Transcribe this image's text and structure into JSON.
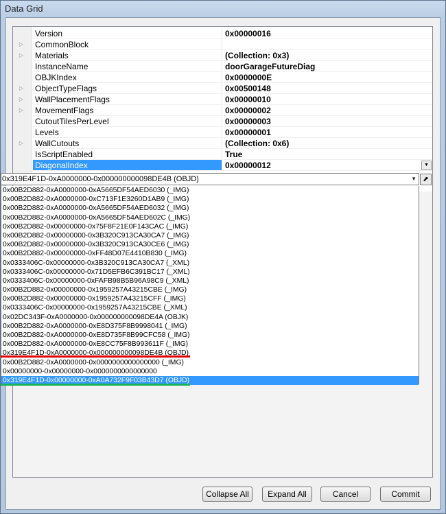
{
  "window": {
    "title": "Data Grid"
  },
  "properties": [
    {
      "name": "Version",
      "value": "0x00000016",
      "expandable": false
    },
    {
      "name": "CommonBlock",
      "value": "",
      "expandable": true
    },
    {
      "name": "Materials",
      "value": "(Collection: 0x3)",
      "expandable": true
    },
    {
      "name": "InstanceName",
      "value": "doorGarageFutureDiag",
      "expandable": false
    },
    {
      "name": "OBJKIndex",
      "value": "0x0000000E",
      "expandable": false
    },
    {
      "name": "ObjectTypeFlags",
      "value": "0x00500148",
      "expandable": true
    },
    {
      "name": "WallPlacementFlags",
      "value": "0x00000010",
      "expandable": true
    },
    {
      "name": "MovementFlags",
      "value": "0x00000002",
      "expandable": true
    },
    {
      "name": "CutoutTilesPerLevel",
      "value": "0x00000003",
      "expandable": false
    },
    {
      "name": "Levels",
      "value": "0x00000001",
      "expandable": false
    },
    {
      "name": "WallCutouts",
      "value": "(Collection: 0x6)",
      "expandable": true
    },
    {
      "name": "IsScriptEnabled",
      "value": "True",
      "expandable": false
    },
    {
      "name": "DiagonalIndex",
      "value": "0x00000012",
      "expandable": false,
      "selected": true
    }
  ],
  "combo": {
    "selected_value": "0x319E4F1D-0xA0000000-0x000000000098DE4B (OBJD)"
  },
  "dropdown_items": [
    "0x00B2D882-0xA0000000-0xA5665DF54AED6030 (_IMG)",
    "0x00B2D882-0xA0000000-0xC713F1E3260D1AB9 (_IMG)",
    "0x00B2D882-0xA0000000-0xA5665DF54AED6032 (_IMG)",
    "0x00B2D882-0xA0000000-0xA5665DF54AED602C (_IMG)",
    "0x00B2D882-0x00000000-0x75F8F21E0F143CAC (_IMG)",
    "0x00B2D882-0x00000000-0x3B320C913CA30CA7 (_IMG)",
    "0x00B2D882-0x00000000-0x3B320C913CA30CE6 (_IMG)",
    "0x00B2D882-0x00000000-0xFF48D07E4410B830 (_IMG)",
    "0x0333406C-0x00000000-0x3B320C913CA30CA7 (_XML)",
    "0x0333406C-0x00000000-0x71D5EFB6C391BC17 (_XML)",
    "0x0333406C-0x00000000-0xFAFB98B5B96A98C9 (_XML)",
    "0x00B2D882-0x00000000-0x1959257A43215CBE (_IMG)",
    "0x00B2D882-0x00000000-0x1959257A43215CFF (_IMG)",
    "0x0333406C-0x00000000-0x1959257A43215CBE (_XML)",
    "0x02DC343F-0xA0000000-0x000000000098DE4A (OBJK)",
    "0x00B2D882-0xA0000000-0xE8D375F8B9998041 (_IMG)",
    "0x00B2D882-0xA0000000-0xE8D735F8B99CFC58 (_IMG)",
    "0x00B2D882-0xA0000000-0xE8CC75F8B993611F (_IMG)",
    "0x319E4F1D-0xA0000000-0x000000000098DE4B (OBJD)",
    "0x00B2D882-0xA0000000-0x0000000000000000 (_IMG)",
    "0x00000000-0x00000000-0x0000000000000000",
    "0x319E4F1D-0x00000000-0xA0A732F9F03B43D7 (OBJD)"
  ],
  "selected_dropdown_index": 21,
  "buttons": {
    "collapse_all": "Collapse All",
    "expand_all": "Expand All",
    "cancel": "Cancel",
    "commit": "Commit"
  },
  "annotations": {
    "red_underline_color": "#e00000",
    "green_underline_color": "#1db35b"
  }
}
